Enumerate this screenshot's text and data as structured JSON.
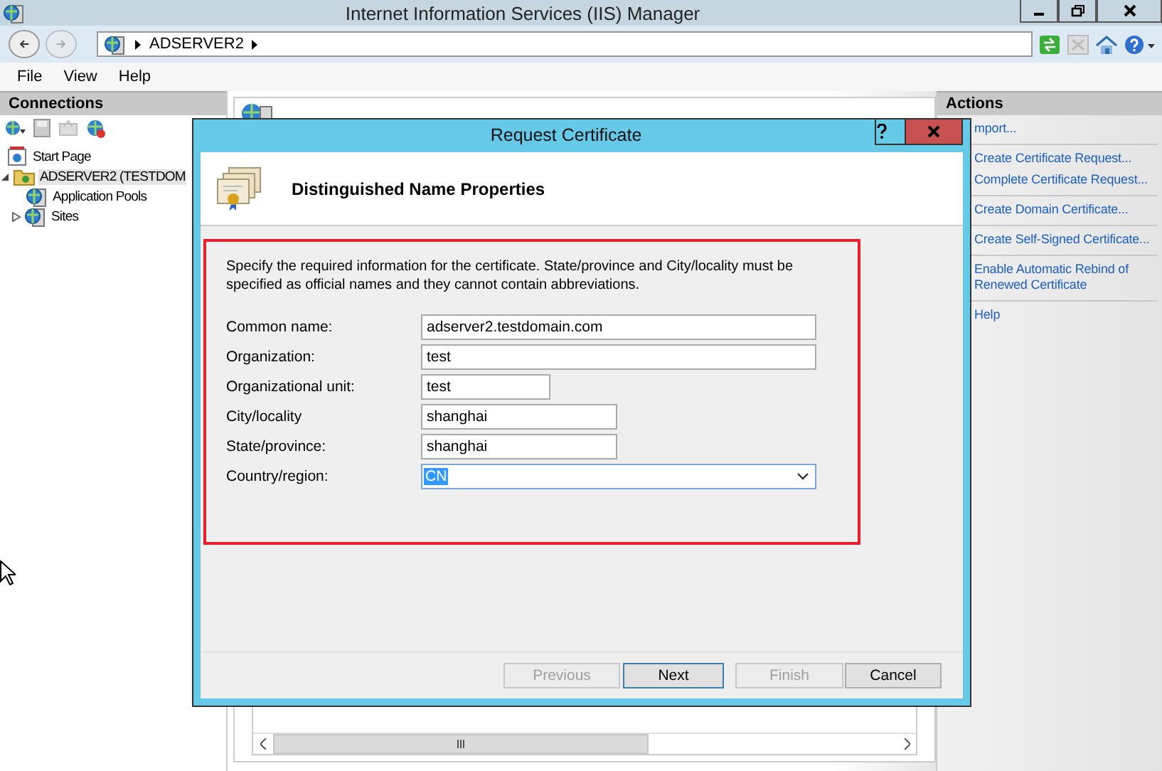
{
  "window": {
    "title": "Internet Information Services (IIS) Manager"
  },
  "address_bar": {
    "path": [
      "ADSERVER2"
    ]
  },
  "menu": [
    "File",
    "View",
    "Help"
  ],
  "connections": {
    "title": "Connections",
    "tree": [
      {
        "label": "Start Page",
        "selected": false
      },
      {
        "label": "ADSERVER2 (TESTDOM",
        "selected": true,
        "expanded": true,
        "children": [
          {
            "label": "Application Pools",
            "selected": false
          },
          {
            "label": "Sites",
            "selected": false,
            "expanded": false
          }
        ]
      }
    ]
  },
  "actions": {
    "title": "Actions",
    "groups": [
      [
        "mport..."
      ],
      [
        "Create Certificate Request...",
        "Complete Certificate Request..."
      ],
      [
        "Create Domain Certificate..."
      ],
      [
        "Create Self-Signed Certificate..."
      ],
      [
        "Enable Automatic Rebind of Renewed Certificate"
      ],
      [
        "Help"
      ]
    ]
  },
  "dialog": {
    "title": "Request Certificate",
    "heading": "Distinguished Name Properties",
    "instructions": "Specify the required information for the certificate. State/province and City/locality must be specified as official names and they cannot contain abbreviations.",
    "fields": [
      {
        "label": "Common name:",
        "value": "adserver2.testdomain.com",
        "kind": "text"
      },
      {
        "label": "Organization:",
        "value": "test",
        "kind": "text"
      },
      {
        "label": "Organizational unit:",
        "value": "test",
        "kind": "text"
      },
      {
        "label": "City/locality",
        "value": "shanghai",
        "kind": "text"
      },
      {
        "label": "State/province:",
        "value": "shanghai",
        "kind": "text"
      },
      {
        "label": "Country/region:",
        "value": "CN",
        "kind": "dropdown",
        "highlighted": true
      }
    ],
    "buttons": [
      {
        "label": "Previous",
        "disabled": true,
        "default": false
      },
      {
        "label": "Next",
        "disabled": false,
        "default": true
      },
      {
        "label": "Finish",
        "disabled": true,
        "default": false
      },
      {
        "label": "Cancel",
        "disabled": false,
        "default": false
      }
    ]
  }
}
